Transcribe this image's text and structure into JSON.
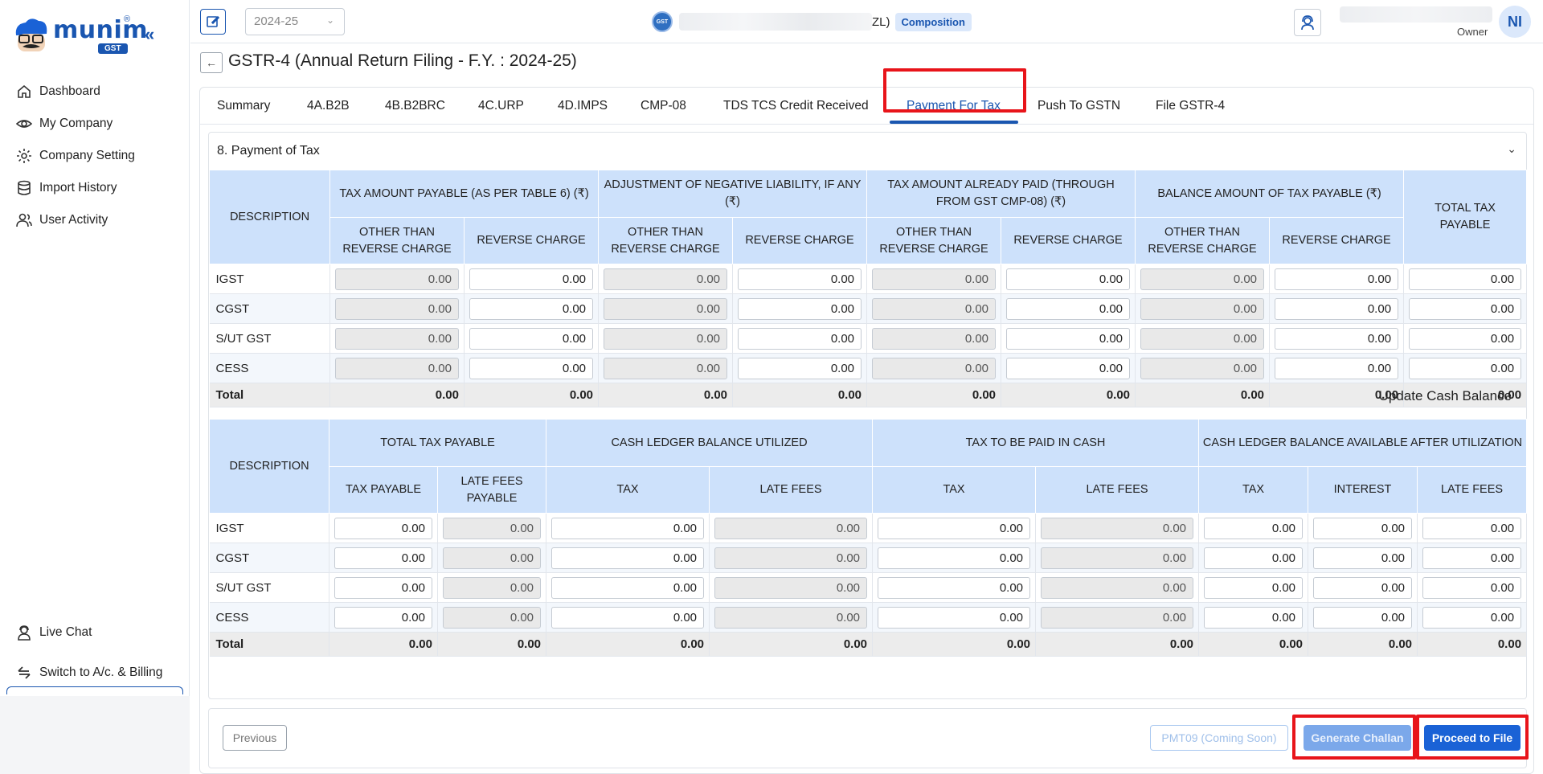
{
  "sidebar": {
    "logo_text": "munim",
    "logo_badge": "GST",
    "logo_reg": "®",
    "collapse_glyph": "«",
    "items": [
      {
        "label": "Dashboard",
        "icon": "home-icon"
      },
      {
        "label": "My Company",
        "icon": "eye-icon"
      },
      {
        "label": "Company Setting",
        "icon": "gear-icon"
      },
      {
        "label": "Import History",
        "icon": "database-icon"
      },
      {
        "label": "User Activity",
        "icon": "users-icon"
      }
    ],
    "bottom_items": [
      {
        "label": "Live Chat",
        "icon": "chat-agent-icon"
      },
      {
        "label": "Switch to A/c. & Billing",
        "icon": "switch-icon"
      }
    ]
  },
  "topbar": {
    "year": "2024-25",
    "company_suffix": "ZL)",
    "company_badge": "Composition",
    "gst_seal": "GST",
    "user_role": "Owner",
    "avatar_initials": "NI"
  },
  "page": {
    "title": "GSTR-4 (Annual Return Filing - F.Y. : 2024-25)",
    "back_glyph": "←"
  },
  "tabs": [
    "Summary",
    "4A.B2B",
    "4B.B2BRC",
    "4C.URP",
    "4D.IMPS",
    "CMP-08",
    "TDS TCS Credit Received",
    "Payment For Tax",
    "Push To GSTN",
    "File GSTR-4"
  ],
  "active_tab": "Payment For Tax",
  "section": {
    "title": "8. Payment of Tax",
    "caret": "⌄"
  },
  "table1": {
    "desc_header": "DESCRIPTION",
    "groups": [
      "TAX AMOUNT PAYABLE (AS PER TABLE 6) (₹)",
      "ADJUSTMENT OF NEGATIVE LIABILITY, IF ANY (₹)",
      "TAX AMOUNT ALREADY PAID (THROUGH FROM GST CMP-08) (₹)",
      "BALANCE AMOUNT OF TAX PAYABLE (₹)"
    ],
    "last_header": "TOTAL TAX PAYABLE",
    "sub_a": "OTHER THAN REVERSE CHARGE",
    "sub_b": "REVERSE CHARGE",
    "rows": [
      {
        "label": "IGST",
        "values": [
          "0.00",
          "0.00",
          "0.00",
          "0.00",
          "0.00",
          "0.00",
          "0.00",
          "0.00",
          "0.00"
        ]
      },
      {
        "label": "CGST",
        "values": [
          "0.00",
          "0.00",
          "0.00",
          "0.00",
          "0.00",
          "0.00",
          "0.00",
          "0.00",
          "0.00"
        ]
      },
      {
        "label": "S/UT GST",
        "values": [
          "0.00",
          "0.00",
          "0.00",
          "0.00",
          "0.00",
          "0.00",
          "0.00",
          "0.00",
          "0.00"
        ]
      },
      {
        "label": "CESS",
        "values": [
          "0.00",
          "0.00",
          "0.00",
          "0.00",
          "0.00",
          "0.00",
          "0.00",
          "0.00",
          "0.00"
        ]
      }
    ],
    "total": {
      "label": "Total",
      "values": [
        "0.00",
        "0.00",
        "0.00",
        "0.00",
        "0.00",
        "0.00",
        "0.00",
        "0.00",
        "0.00"
      ]
    }
  },
  "update_cash_label": "Update Cash Balance",
  "table2": {
    "desc_header": "DESCRIPTION",
    "groups": [
      "TOTAL TAX PAYABLE",
      "CASH LEDGER BALANCE UTILIZED",
      "TAX TO BE PAID IN CASH",
      "CASH LEDGER BALANCE AVAILABLE AFTER UTILIZATION"
    ],
    "subs": [
      "TAX PAYABLE",
      "LATE FEES PAYABLE",
      "TAX",
      "LATE FEES",
      "TAX",
      "LATE FEES",
      "TAX",
      "INTEREST",
      "LATE FEES"
    ],
    "rows": [
      {
        "label": "IGST",
        "values": [
          "0.00",
          "0.00",
          "0.00",
          "0.00",
          "0.00",
          "0.00",
          "0.00",
          "0.00",
          "0.00"
        ]
      },
      {
        "label": "CGST",
        "values": [
          "0.00",
          "0.00",
          "0.00",
          "0.00",
          "0.00",
          "0.00",
          "0.00",
          "0.00",
          "0.00"
        ]
      },
      {
        "label": "S/UT GST",
        "values": [
          "0.00",
          "0.00",
          "0.00",
          "0.00",
          "0.00",
          "0.00",
          "0.00",
          "0.00",
          "0.00"
        ]
      },
      {
        "label": "CESS",
        "values": [
          "0.00",
          "0.00",
          "0.00",
          "0.00",
          "0.00",
          "0.00",
          "0.00",
          "0.00",
          "0.00"
        ]
      }
    ],
    "total": {
      "label": "Total",
      "values": [
        "0.00",
        "0.00",
        "0.00",
        "0.00",
        "0.00",
        "0.00",
        "0.00",
        "0.00",
        "0.00"
      ]
    }
  },
  "footer": {
    "previous": "Previous",
    "pmt09": "PMT09 (Coming Soon)",
    "generate_challan": "Generate Challan",
    "proceed": "Proceed to File"
  },
  "colors": {
    "accent": "#1a56b0",
    "header_bg": "#cde1fb",
    "highlight": "#e8141a"
  }
}
